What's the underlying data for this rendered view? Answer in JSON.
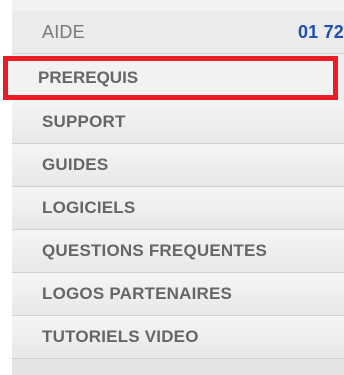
{
  "menu": {
    "header": {
      "label": "AIDE",
      "phone": "01 72"
    },
    "items": [
      {
        "label": "PREREQUIS",
        "selected": true
      },
      {
        "label": "SUPPORT"
      },
      {
        "label": "GUIDES"
      },
      {
        "label": "LOGICIELS"
      },
      {
        "label": "QUESTIONS FREQUENTES"
      },
      {
        "label": "LOGOS PARTENAIRES"
      },
      {
        "label": "TUTORIELS VIDEO"
      }
    ]
  },
  "colors": {
    "highlight": "#ec1c24",
    "phone": "#1f4fb5",
    "text": "#666666"
  }
}
